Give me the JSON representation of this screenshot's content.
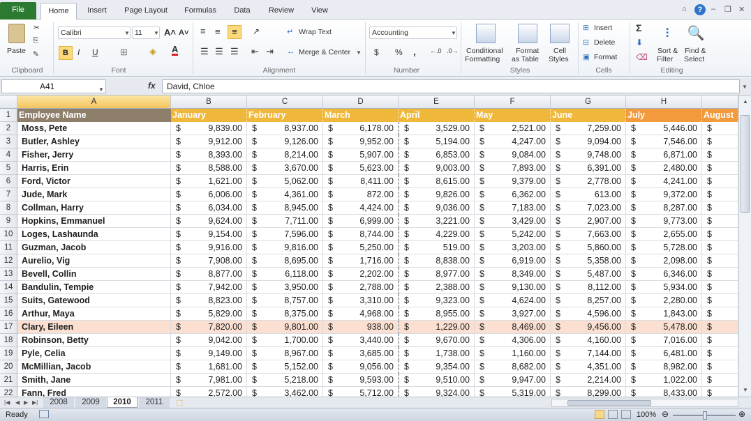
{
  "ribbon_tabs": [
    "File",
    "Home",
    "Insert",
    "Page Layout",
    "Formulas",
    "Data",
    "Review",
    "View"
  ],
  "ribbon": {
    "clipboard": {
      "paste": "Paste",
      "label": "Clipboard"
    },
    "font": {
      "name": "Calibri",
      "size": "11",
      "bold": "B",
      "italic": "I",
      "underline": "U",
      "label": "Font"
    },
    "alignment": {
      "wrap": "Wrap Text",
      "merge": "Merge & Center",
      "label": "Alignment"
    },
    "number": {
      "format": "Accounting",
      "dollar": "$",
      "percent": "%",
      "comma": ",",
      "label": "Number"
    },
    "styles": {
      "conditional_1": "Conditional",
      "conditional_2": "Formatting",
      "format_table_1": "Format",
      "format_table_2": "as Table",
      "cell_styles_1": "Cell",
      "cell_styles_2": "Styles",
      "label": "Styles"
    },
    "cells": {
      "insert": "Insert",
      "delete": "Delete",
      "format": "Format",
      "label": "Cells"
    },
    "editing": {
      "sort_1": "Sort &",
      "sort_2": "Filter",
      "find_1": "Find &",
      "find_2": "Select",
      "label": "Editing"
    }
  },
  "formula_bar": {
    "name_box": "A41",
    "fx": "fx",
    "content": "David, Chloe"
  },
  "columns": [
    "A",
    "B",
    "C",
    "D",
    "E",
    "F",
    "G",
    "H"
  ],
  "header_row": [
    "Employee Name",
    "January",
    "February",
    "March",
    "April",
    "May",
    "June",
    "July",
    "August"
  ],
  "rows": [
    {
      "n": "2",
      "name": "Moss, Pete",
      "v": [
        "9,839.00",
        "8,937.00",
        "6,178.00",
        "3,529.00",
        "2,521.00",
        "7,259.00",
        "5,446.00"
      ]
    },
    {
      "n": "3",
      "name": "Butler, Ashley",
      "v": [
        "9,912.00",
        "9,126.00",
        "9,952.00",
        "5,194.00",
        "4,247.00",
        "9,094.00",
        "7,546.00"
      ]
    },
    {
      "n": "4",
      "name": "Fisher, Jerry",
      "v": [
        "8,393.00",
        "8,214.00",
        "5,907.00",
        "6,853.00",
        "9,084.00",
        "9,748.00",
        "6,871.00"
      ]
    },
    {
      "n": "5",
      "name": "Harris, Erin",
      "v": [
        "8,588.00",
        "3,670.00",
        "5,623.00",
        "9,003.00",
        "7,893.00",
        "6,391.00",
        "2,480.00"
      ]
    },
    {
      "n": "6",
      "name": "Ford, Victor",
      "v": [
        "1,621.00",
        "5,062.00",
        "8,411.00",
        "8,615.00",
        "9,379.00",
        "2,778.00",
        "4,241.00"
      ]
    },
    {
      "n": "7",
      "name": "Jude, Mark",
      "v": [
        "6,006.00",
        "4,361.00",
        "872.00",
        "9,826.00",
        "6,362.00",
        "613.00",
        "9,372.00"
      ]
    },
    {
      "n": "8",
      "name": "Collman, Harry",
      "v": [
        "6,034.00",
        "8,945.00",
        "4,424.00",
        "9,036.00",
        "7,183.00",
        "7,023.00",
        "8,287.00"
      ]
    },
    {
      "n": "9",
      "name": "Hopkins, Emmanuel",
      "v": [
        "9,624.00",
        "7,711.00",
        "6,999.00",
        "3,221.00",
        "3,429.00",
        "2,907.00",
        "9,773.00"
      ]
    },
    {
      "n": "10",
      "name": "Loges, Lashaunda",
      "v": [
        "9,154.00",
        "7,596.00",
        "8,744.00",
        "4,229.00",
        "5,242.00",
        "7,663.00",
        "2,655.00"
      ]
    },
    {
      "n": "11",
      "name": "Guzman, Jacob",
      "v": [
        "9,916.00",
        "9,816.00",
        "5,250.00",
        "519.00",
        "3,203.00",
        "5,860.00",
        "5,728.00"
      ]
    },
    {
      "n": "12",
      "name": "Aurelio, Vig",
      "v": [
        "7,908.00",
        "8,695.00",
        "1,716.00",
        "8,838.00",
        "6,919.00",
        "5,358.00",
        "2,098.00"
      ]
    },
    {
      "n": "13",
      "name": "Bevell, Collin",
      "v": [
        "8,877.00",
        "6,118.00",
        "2,202.00",
        "8,977.00",
        "8,349.00",
        "5,487.00",
        "6,346.00"
      ]
    },
    {
      "n": "14",
      "name": "Bandulin, Tempie",
      "v": [
        "7,942.00",
        "3,950.00",
        "2,788.00",
        "2,388.00",
        "9,130.00",
        "8,112.00",
        "5,934.00"
      ]
    },
    {
      "n": "15",
      "name": "Suits, Gatewood",
      "v": [
        "8,823.00",
        "8,757.00",
        "3,310.00",
        "9,323.00",
        "4,624.00",
        "8,257.00",
        "2,280.00"
      ]
    },
    {
      "n": "16",
      "name": "Arthur, Maya",
      "v": [
        "5,829.00",
        "8,375.00",
        "4,968.00",
        "8,955.00",
        "3,927.00",
        "4,596.00",
        "1,843.00"
      ]
    },
    {
      "n": "17",
      "name": "Clary, Eileen",
      "v": [
        "7,820.00",
        "9,801.00",
        "938.00",
        "1,229.00",
        "8,469.00",
        "9,456.00",
        "5,478.00"
      ]
    },
    {
      "n": "18",
      "name": "Robinson, Betty",
      "v": [
        "9,042.00",
        "1,700.00",
        "3,440.00",
        "9,670.00",
        "4,306.00",
        "4,160.00",
        "7,016.00"
      ]
    },
    {
      "n": "19",
      "name": "Pyle, Celia",
      "v": [
        "9,149.00",
        "8,967.00",
        "3,685.00",
        "1,738.00",
        "1,160.00",
        "7,144.00",
        "6,481.00"
      ]
    },
    {
      "n": "20",
      "name": "McMillian, Jacob",
      "v": [
        "1,681.00",
        "5,152.00",
        "9,056.00",
        "9,354.00",
        "8,682.00",
        "4,351.00",
        "8,982.00"
      ]
    },
    {
      "n": "21",
      "name": "Smith, Jane",
      "v": [
        "7,981.00",
        "5,218.00",
        "9,593.00",
        "9,510.00",
        "9,947.00",
        "2,214.00",
        "1,022.00"
      ]
    },
    {
      "n": "22",
      "name": "Fann, Fred",
      "v": [
        "2,572.00",
        "3,462.00",
        "5,712.00",
        "9,324.00",
        "5,319.00",
        "8,299.00",
        "8,433.00"
      ]
    }
  ],
  "currency": "$",
  "sheet_tabs": [
    "2008",
    "2009",
    "2010",
    "2011"
  ],
  "active_sheet": "2010",
  "status": {
    "ready": "Ready",
    "zoom": "100%"
  },
  "colors": {
    "header_gold": "#f0b83a",
    "header_orange": "#f39a3c",
    "name_header": "#8e7f6b",
    "highlight_row": "#fbe0d2",
    "file_tab": "#2c7a32"
  }
}
